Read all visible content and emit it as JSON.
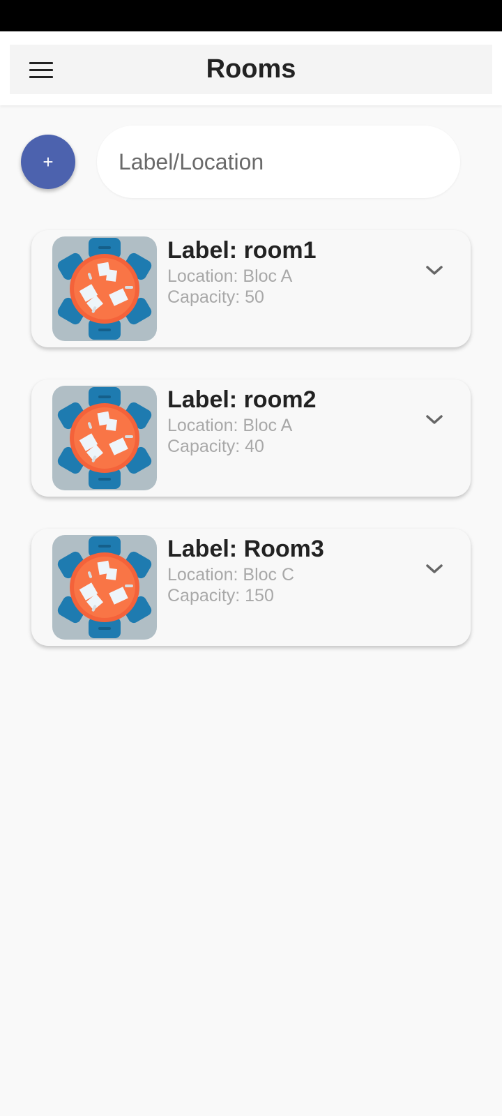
{
  "app_bar": {
    "title": "Rooms",
    "menu_icon": "hamburger-menu-icon"
  },
  "toolbar": {
    "add_label": "+",
    "search_placeholder": "Label/Location"
  },
  "rooms": [
    {
      "label": "Label: room1",
      "location": "Location: Bloc A",
      "capacity": "Capacity: 50",
      "image_icon": "meeting-room-icon",
      "expand_icon": "chevron-down-icon"
    },
    {
      "label": "Label: room2",
      "location": "Location: Bloc A",
      "capacity": "Capacity: 40",
      "image_icon": "meeting-room-icon",
      "expand_icon": "chevron-down-icon"
    },
    {
      "label": "Label: Room3",
      "location": "Location: Bloc C",
      "capacity": "Capacity: 150",
      "image_icon": "meeting-room-icon",
      "expand_icon": "chevron-down-icon"
    }
  ],
  "colors": {
    "accent": "#4c62ae",
    "status_bar": "#000000",
    "table": "#f4623a",
    "chair": "#1e7bb0",
    "image_bg": "#b0bec5"
  }
}
